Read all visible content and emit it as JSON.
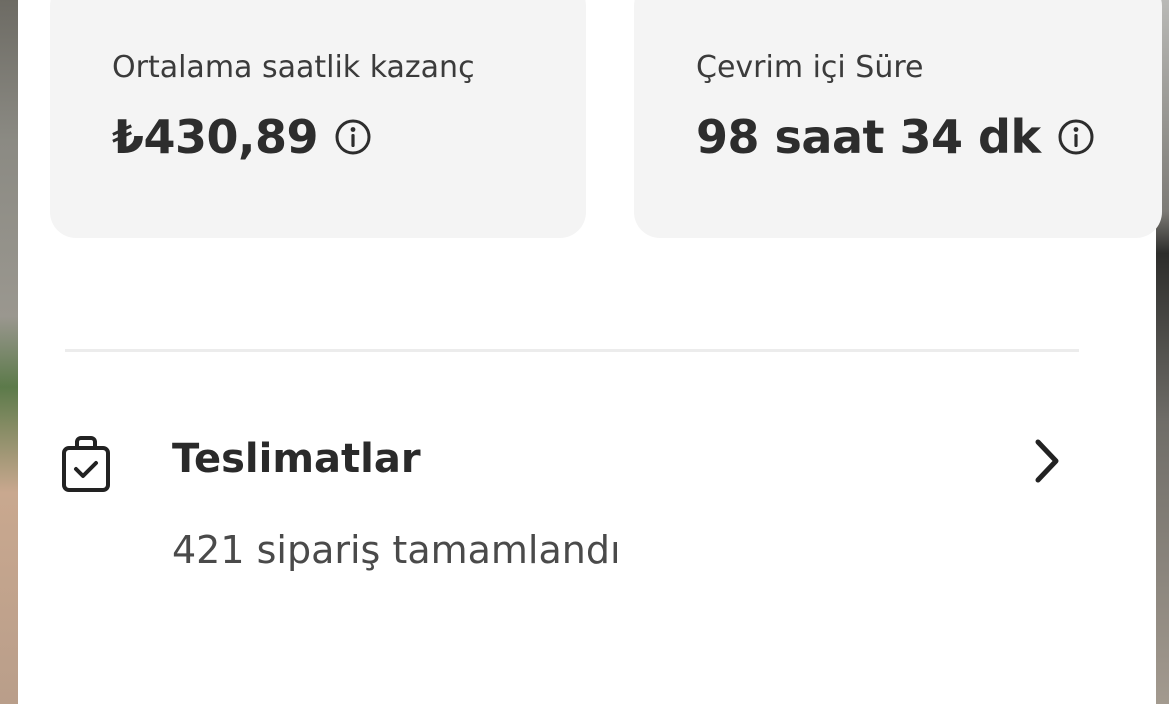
{
  "cards": [
    {
      "label": "Ortalama saatlik kazanç",
      "value": "₺430,89",
      "icon": "info-icon"
    },
    {
      "label": "Çevrim içi Süre",
      "value": "98 saat 34 dk",
      "icon": "info-icon"
    }
  ],
  "deliveries": {
    "icon": "shopping-bag-check-icon",
    "title": "Teslimatlar",
    "subtitle": "421 sipariş tamamlandı",
    "chevron": "chevron-right-icon"
  },
  "colors": {
    "card_bg": "#f4f4f4",
    "text_primary": "#2d2d2d",
    "text_secondary": "#4a4a4a",
    "divider": "#ececec"
  }
}
